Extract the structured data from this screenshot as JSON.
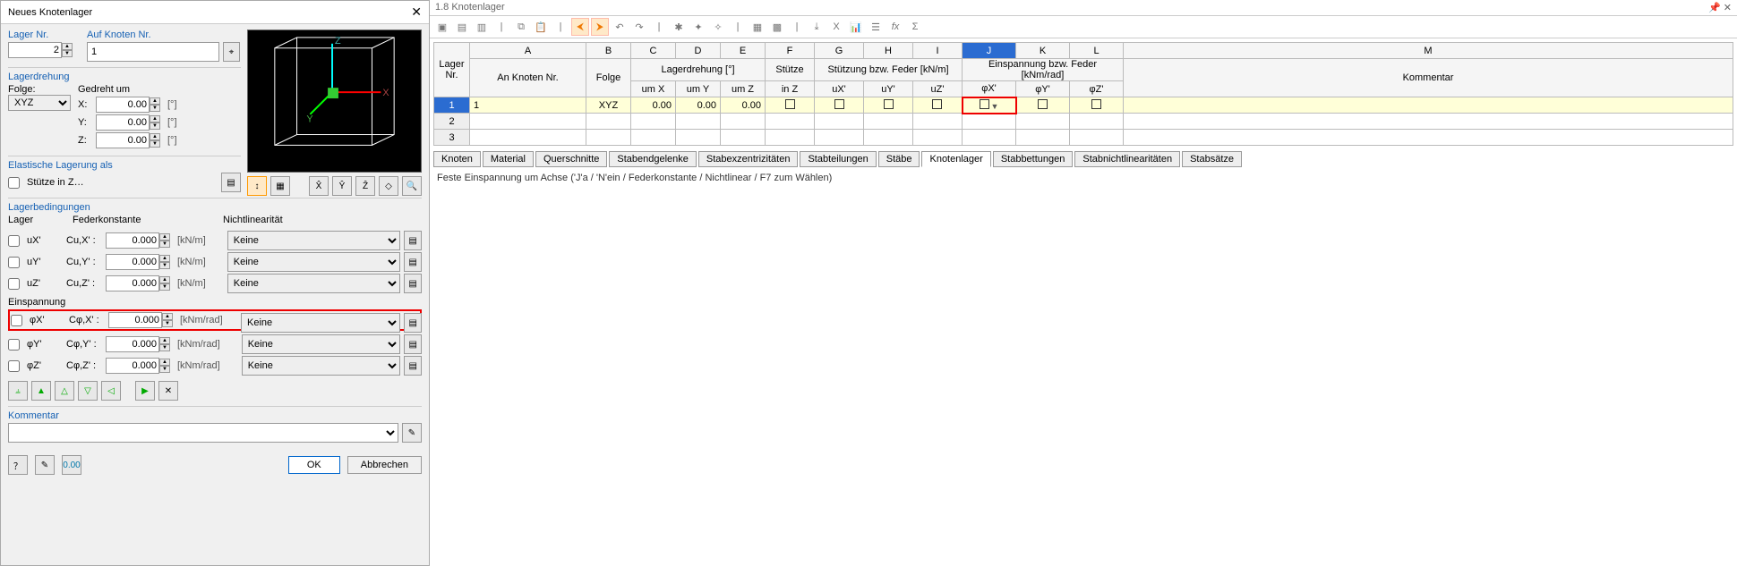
{
  "dialog": {
    "title": "Neues Knotenlager",
    "lagerNr_label": "Lager Nr.",
    "lagerNr_value": "2",
    "aufKnoten_label": "Auf Knoten Nr.",
    "aufKnoten_value": "1",
    "lagerdrehung_label": "Lagerdrehung",
    "folge_label": "Folge:",
    "folge_value": "XYZ",
    "gedreht_label": "Gedreht um",
    "rotX_label": "X:",
    "rotX_value": "0.00",
    "rotY_label": "Y:",
    "rotY_value": "0.00",
    "rotZ_label": "Z:",
    "rotZ_value": "0.00",
    "rot_unit": "[°]",
    "elastisch_label": "Elastische Lagerung als",
    "stuetze_label": "Stütze in Z…",
    "lagerbed_label": "Lagerbedingungen",
    "lager_col": "Lager",
    "feder_col": "Federkonstante",
    "nichtlin_col": "Nichtlinearität",
    "ux_label": "uX'",
    "uy_label": "uY'",
    "uz_label": "uZ'",
    "cux_label": "Cu,X' :",
    "cuy_label": "Cu,Y' :",
    "cuz_label": "Cu,Z' :",
    "einsp_label": "Einspannung",
    "phix_label": "φX'",
    "phiy_label": "φY'",
    "phiz_label": "φZ'",
    "cphix_label": "Cφ,X' :",
    "cphiy_label": "Cφ,Y' :",
    "cphiz_label": "Cφ,Z' :",
    "val_0000": "0.000",
    "unit_kNm": "[kN/m]",
    "unit_kNmrad": "[kNm/rad]",
    "keine": "Keine",
    "kommentar_label": "Kommentar",
    "ok_label": "OK",
    "cancel_label": "Abbrechen"
  },
  "pane": {
    "title": "1.8 Knotenlager",
    "cols": [
      "A",
      "B",
      "C",
      "D",
      "E",
      "F",
      "G",
      "H",
      "I",
      "J",
      "K",
      "L",
      "M"
    ],
    "h_lagernr": "Lager\nNr.",
    "h_anknoten": "An Knoten Nr.",
    "h_folge": "Folge",
    "h_lagerdrehung": "Lagerdrehung [°]",
    "h_umX": "um X",
    "h_umY": "um Y",
    "h_umZ": "um Z",
    "h_stuetze": "Stütze",
    "h_inZ": "in Z",
    "h_stuetzung": "Stützung bzw. Feder [kN/m]",
    "h_uX": "uX'",
    "h_uY": "uY'",
    "h_uZ": "uZ'",
    "h_einsp": "Einspannung bzw. Feder [kNm/rad]",
    "h_phiX": "φX'",
    "h_phiY": "φY'",
    "h_phiZ": "φZ'",
    "h_kommentar": "Kommentar",
    "r1": {
      "n": "1",
      "an": "1",
      "folge": "XYZ",
      "x": "0.00",
      "y": "0.00",
      "z": "0.00"
    },
    "r2": "2",
    "r3": "3",
    "tabs": [
      "Knoten",
      "Material",
      "Querschnitte",
      "Stabendgelenke",
      "Stabexzentrizitäten",
      "Stabteilungen",
      "Stäbe",
      "Knotenlager",
      "Stabbettungen",
      "Stabnichtlinearitäten",
      "Stabsätze"
    ],
    "status": "Feste Einspannung um Achse ('J'a / 'N'ein / Federkonstante / Nichtlinear / F7 zum Wählen)"
  }
}
